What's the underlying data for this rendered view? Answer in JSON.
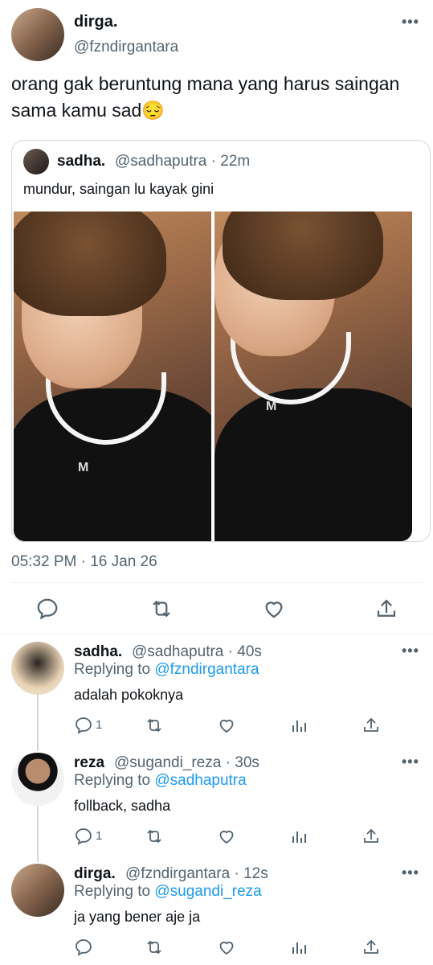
{
  "main_tweet": {
    "name": "dirga.",
    "handle": "@fzndirgantara",
    "text": "orang gak beruntung mana yang harus saingan sama kamu sad😔",
    "timestamp": "05:32 PM · 16 Jan 26",
    "avatar_icon": "profile-photo",
    "more_icon": "more-icon"
  },
  "quote": {
    "name": "sadha.",
    "handle_time": "@sadhaputra · 22m",
    "text": "mundur, saingan lu kayak gini",
    "photo_left_logo": "M",
    "photo_right_logo": "M"
  },
  "actions": {
    "reply_icon": "reply-icon",
    "retweet_icon": "retweet-icon",
    "like_icon": "heart-icon",
    "share_icon": "share-icon",
    "analytics_icon": "analytics-icon"
  },
  "replies": [
    {
      "name": "sadha.",
      "handle_time": "@sadhaputra · 40s",
      "replying_prefix": "Replying to",
      "replying_to": "@fzndirgantara",
      "text": "adalah pokoknya",
      "reply_count": "1"
    },
    {
      "name": "reza",
      "handle_time": "@sugandi_reza · 30s",
      "replying_prefix": "Replying to",
      "replying_to": "@sadhaputra",
      "text": "follback, sadha",
      "reply_count": "1"
    },
    {
      "name": "dirga.",
      "handle_time": "@fzndirgantara · 12s",
      "replying_prefix": "Replying to",
      "replying_to": "@sugandi_reza",
      "text": "ja yang bener aje ja",
      "reply_count": ""
    }
  ],
  "colors": {
    "link": "#1d9bf0",
    "muted": "#536471",
    "border": "#cfd9de"
  }
}
